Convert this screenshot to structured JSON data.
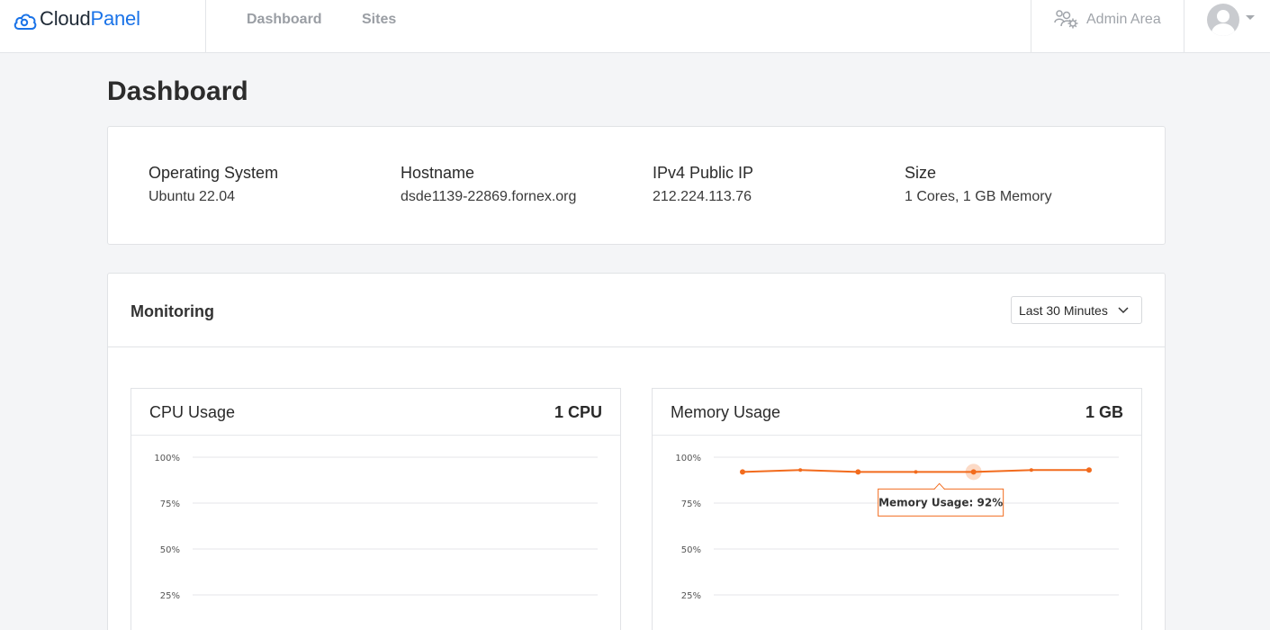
{
  "brand": {
    "part1": "Cloud",
    "part2": "Panel"
  },
  "nav": {
    "dashboard": "Dashboard",
    "sites": "Sites",
    "admin": "Admin Area"
  },
  "page": {
    "title": "Dashboard"
  },
  "info": [
    {
      "label": "Operating System",
      "value": "Ubuntu 22.04"
    },
    {
      "label": "Hostname",
      "value": "dsde1139-22869.fornex.org"
    },
    {
      "label": "IPv4 Public IP",
      "value": "212.224.113.76"
    },
    {
      "label": "Size",
      "value": "1 Cores, 1 GB Memory"
    }
  ],
  "monitoring": {
    "title": "Monitoring",
    "range_selected": "Last 30 Minutes"
  },
  "colors": {
    "accent": "#1a73e8",
    "series": "#f26b1d"
  },
  "chart_data": [
    {
      "type": "line",
      "title": "CPU Usage",
      "meta": "1 CPU",
      "yticks": [
        "100%",
        "75%",
        "50%",
        "25%"
      ],
      "ylim": [
        0,
        100
      ],
      "series": []
    },
    {
      "type": "line",
      "title": "Memory Usage",
      "meta": "1 GB",
      "yticks": [
        "100%",
        "75%",
        "50%",
        "25%"
      ],
      "ylim": [
        0,
        100
      ],
      "series": [
        {
          "values": [
            92,
            93,
            92,
            92,
            92,
            93,
            93
          ]
        }
      ],
      "tooltip": {
        "text": "Memory Usage: 92%",
        "index": 4
      }
    }
  ]
}
